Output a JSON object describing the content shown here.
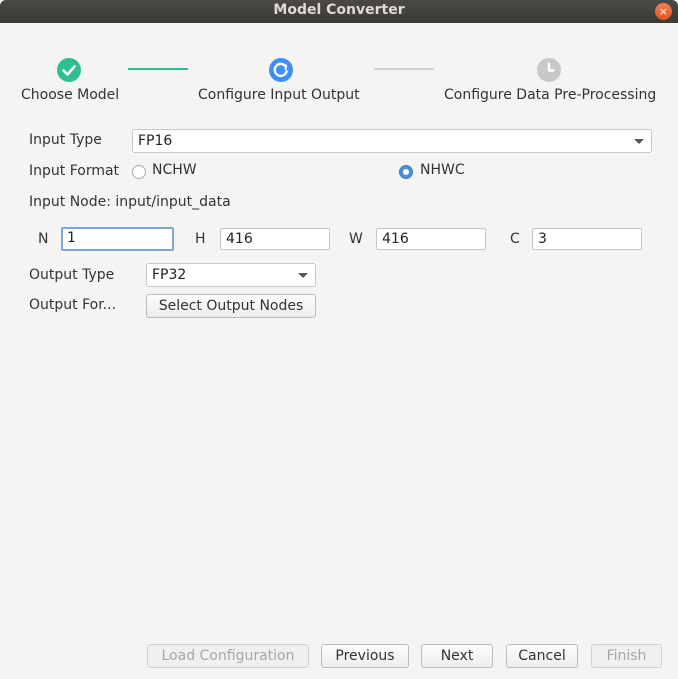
{
  "window": {
    "title": "Model Converter",
    "close_glyph": "×"
  },
  "steps": [
    {
      "label": "Choose Model",
      "state": "done",
      "icon": "check-icon"
    },
    {
      "label": "Configure Input  Output",
      "state": "current",
      "icon": "refresh-icon"
    },
    {
      "label": "Configure Data Pre-Processing",
      "state": "pending",
      "icon": "clock-icon"
    }
  ],
  "colors": {
    "done": "#2fbf8f",
    "current": "#3e8ef7",
    "pending": "#c8c8c8",
    "radio_selected": "#4a90d9"
  },
  "form": {
    "input_type_label": "Input Type",
    "input_type_value": "FP16",
    "input_format_label": "Input Format",
    "format_options": [
      {
        "label": "NCHW",
        "selected": false
      },
      {
        "label": "NHWC",
        "selected": true
      }
    ],
    "input_node_text": "Input Node: input/input_data",
    "dims": [
      {
        "label": "N",
        "value": "1"
      },
      {
        "label": "H",
        "value": "416"
      },
      {
        "label": "W",
        "value": "416"
      },
      {
        "label": "C",
        "value": "3"
      }
    ],
    "output_type_label": "Output Type",
    "output_type_value": "FP32",
    "output_format_label": "Output For...",
    "select_output_nodes_label": "Select Output Nodes"
  },
  "footer": {
    "load_configuration": "Load Configuration",
    "previous": "Previous",
    "next": "Next",
    "cancel": "Cancel",
    "finish": "Finish"
  }
}
